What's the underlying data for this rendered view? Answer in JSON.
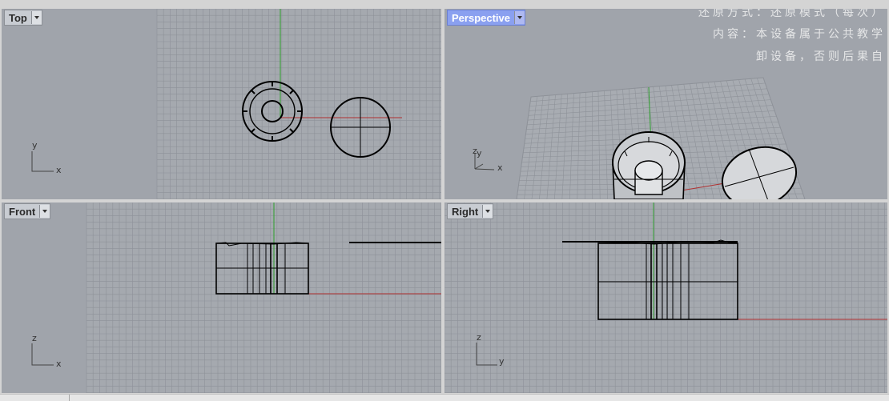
{
  "viewports": {
    "top": {
      "label": "Top",
      "axis_x": "x",
      "axis_y": "y"
    },
    "perspective": {
      "label": "Perspective",
      "axis_x": "x",
      "axis_y": "y",
      "axis_z": "z"
    },
    "front": {
      "label": "Front",
      "axis_x": "x",
      "axis_y": "z"
    },
    "right": {
      "label": "Right",
      "axis_x": "y",
      "axis_y": "z"
    }
  },
  "watermark": {
    "line1": "还原方式：还原模式（每次）",
    "line2": "内容：本设备属于公共教学",
    "line3": "卸设备，否则后果自"
  },
  "colors": {
    "viewport_bg": "#a0a4ab",
    "grid": "#8e9299",
    "x_axis": "#b03030",
    "y_axis": "#2ea02e",
    "active_label": "#8aa0f0"
  }
}
